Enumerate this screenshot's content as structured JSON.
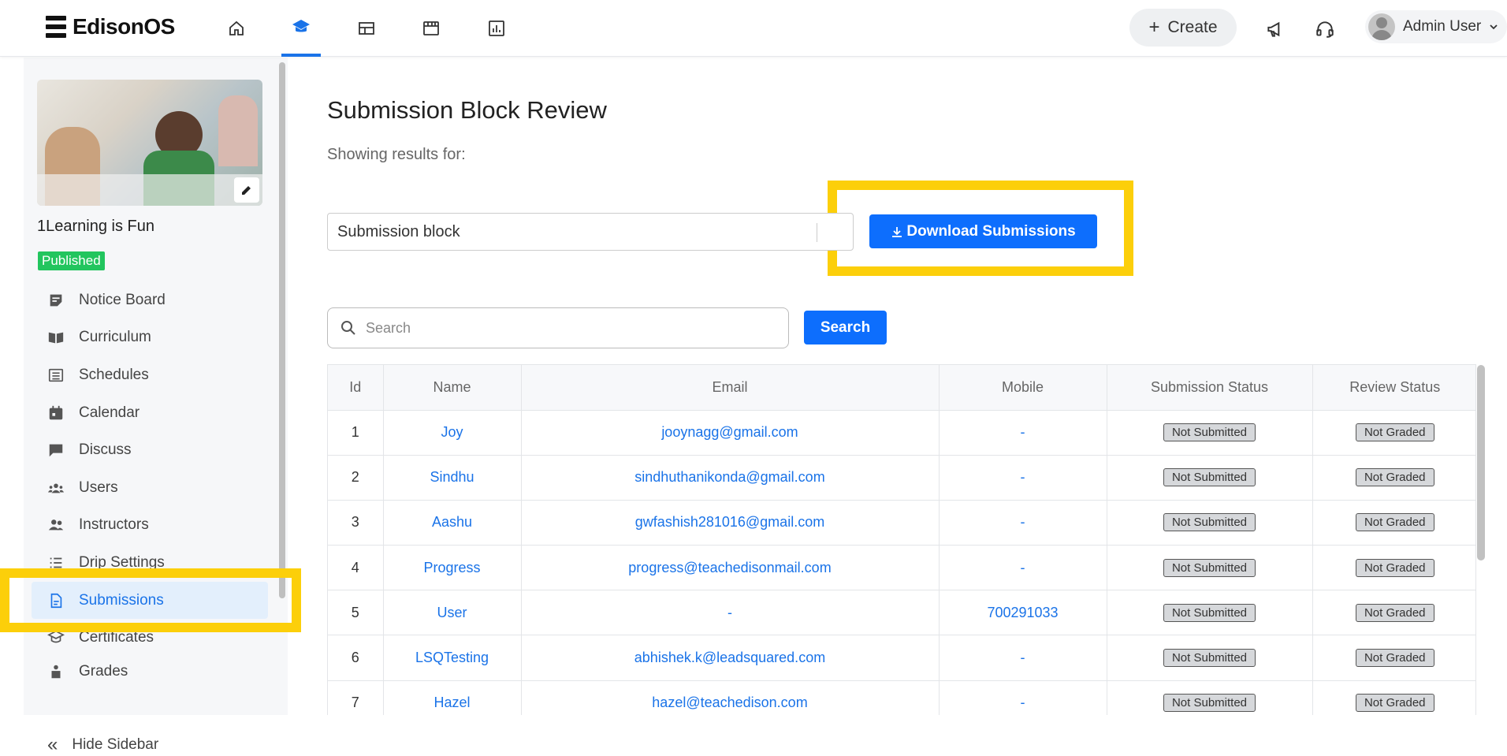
{
  "brand": {
    "name": "EdisonOS"
  },
  "topnav": {
    "icons": [
      "home-icon",
      "courses-icon",
      "layout-icon",
      "store-icon",
      "analytics-icon"
    ],
    "active": "courses-icon",
    "create_label": "Create",
    "user_name": "Admin User"
  },
  "sidebar": {
    "course_title": "1Learning is Fun",
    "status": "Published",
    "items": [
      {
        "label": "Notice Board",
        "icon": "notice-board-icon"
      },
      {
        "label": "Curriculum",
        "icon": "book-icon"
      },
      {
        "label": "Schedules",
        "icon": "list-icon"
      },
      {
        "label": "Calendar",
        "icon": "calendar-icon"
      },
      {
        "label": "Discuss",
        "icon": "chat-icon"
      },
      {
        "label": "Users",
        "icon": "users-icon"
      },
      {
        "label": "Instructors",
        "icon": "instructors-icon"
      },
      {
        "label": "Drip Settings",
        "icon": "drip-list-icon"
      },
      {
        "label": "Submissions",
        "icon": "document-icon",
        "active": true
      },
      {
        "label": "Certificates",
        "icon": "certificate-icon"
      },
      {
        "label": "Grades",
        "icon": "grades-icon"
      }
    ],
    "hide_label": "Hide Sidebar"
  },
  "main": {
    "title": "Submission Block Review",
    "showing": "Showing results for:",
    "block_select": "Submission block",
    "download_label": "Download Submissions",
    "search_placeholder": "Search",
    "search_button": "Search",
    "columns": [
      "Id",
      "Name",
      "Email",
      "Mobile",
      "Submission Status",
      "Review Status"
    ],
    "rows": [
      {
        "id": "1",
        "name": "Joy",
        "email": "jooynagg@gmail.com",
        "mobile": "-",
        "submission": "Not Submitted",
        "review": "Not Graded"
      },
      {
        "id": "2",
        "name": "Sindhu",
        "email": "sindhuthanikonda@gmail.com",
        "mobile": "-",
        "submission": "Not Submitted",
        "review": "Not Graded"
      },
      {
        "id": "3",
        "name": "Aashu",
        "email": "gwfashish281016@gmail.com",
        "mobile": "-",
        "submission": "Not Submitted",
        "review": "Not Graded"
      },
      {
        "id": "4",
        "name": "Progress",
        "email": "progress@teachedisonmail.com",
        "mobile": "-",
        "submission": "Not Submitted",
        "review": "Not Graded"
      },
      {
        "id": "5",
        "name": "User",
        "email": "-",
        "mobile": "700291033",
        "submission": "Not Submitted",
        "review": "Not Graded"
      },
      {
        "id": "6",
        "name": "LSQTesting",
        "email": "abhishek.k@leadsquared.com",
        "mobile": "-",
        "submission": "Not Submitted",
        "review": "Not Graded"
      },
      {
        "id": "7",
        "name": "Hazel",
        "email": "hazel@teachedison.com",
        "mobile": "-",
        "submission": "Not Submitted",
        "review": "Not Graded"
      }
    ]
  },
  "colors": {
    "accent": "#0d6efd",
    "highlight": "#fccf0a",
    "published": "#22c55e"
  }
}
